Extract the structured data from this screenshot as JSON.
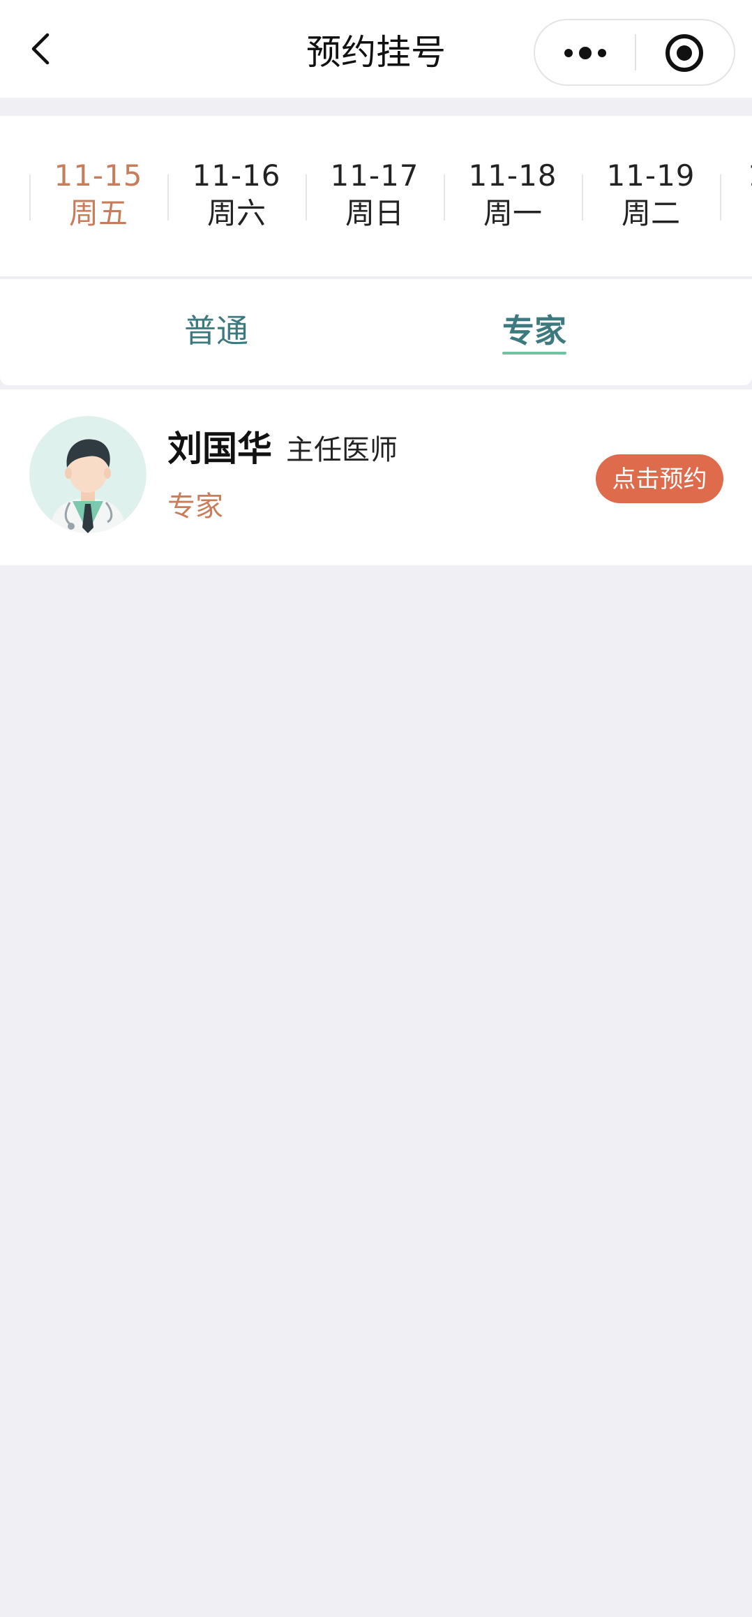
{
  "nav": {
    "title": "预约挂号"
  },
  "dates": [
    {
      "date": "11-15",
      "weekday": "周五",
      "active": true
    },
    {
      "date": "11-16",
      "weekday": "周六",
      "active": false
    },
    {
      "date": "11-17",
      "weekday": "周日",
      "active": false
    },
    {
      "date": "11-18",
      "weekday": "周一",
      "active": false
    },
    {
      "date": "11-19",
      "weekday": "周二",
      "active": false
    },
    {
      "date": "1",
      "weekday": "",
      "active": false
    }
  ],
  "tabs": {
    "normal": "普通",
    "expert": "专家",
    "selected": "expert"
  },
  "doctor": {
    "name": "刘国华",
    "title": "主任医师",
    "type": "专家",
    "book_label": "点击预约"
  },
  "colors": {
    "accent_orange": "#c97c5a",
    "button_orange": "#dd6b4c",
    "tab_teal": "#3d7a80",
    "underline_green": "#6fc3a0",
    "page_bg": "#efeff4"
  }
}
